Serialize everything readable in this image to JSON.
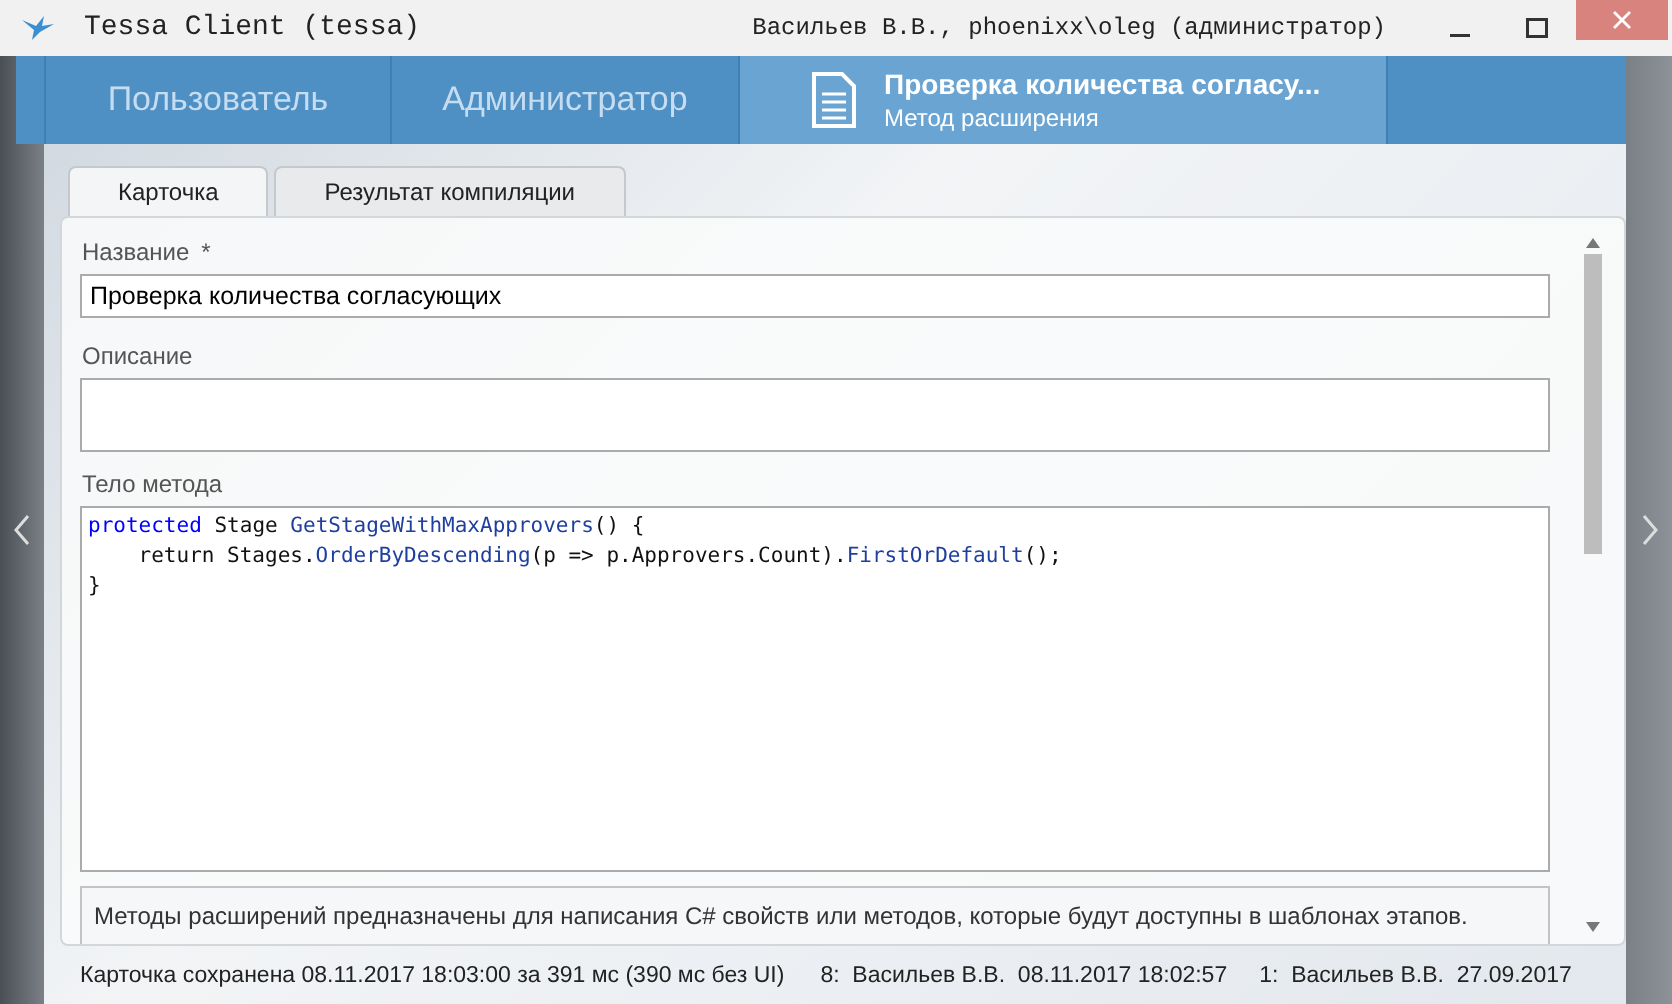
{
  "window": {
    "title": "Tessa Client (tessa)",
    "user": "Васильев В.В., phoenixx\\oleg (администратор)"
  },
  "nav_tabs": [
    {
      "kind": "plain",
      "label": "Пользователь",
      "selected": false
    },
    {
      "kind": "plain",
      "label": "Администратор",
      "selected": false
    },
    {
      "kind": "card",
      "label": "Проверка количества согласу...",
      "subtitle": "Метод расширения",
      "selected": true
    }
  ],
  "tabs": [
    {
      "label": "Карточка",
      "selected": true
    },
    {
      "label": "Результат компиляции",
      "selected": false
    }
  ],
  "fields": [
    {
      "kind": "text",
      "label": "Название",
      "required_mark": "*",
      "value": "Проверка количества согласующих"
    },
    {
      "kind": "multiline",
      "label": "Описание"
    }
  ],
  "code_editor": {
    "label": "Тело метода",
    "lines": [
      [
        {
          "kind": "keyword",
          "text": "protected"
        },
        {
          "kind": "plain",
          "text": " Stage "
        },
        {
          "kind": "method",
          "text": "GetStageWithMaxApprovers"
        },
        {
          "kind": "plain",
          "text": "() {"
        }
      ],
      [
        {
          "kind": "plain",
          "text": "    return Stages."
        },
        {
          "kind": "method",
          "text": "OrderByDescending"
        },
        {
          "kind": "plain",
          "text": "(p => p.Approvers.Count)."
        },
        {
          "kind": "method",
          "text": "FirstOrDefault"
        },
        {
          "kind": "plain",
          "text": "();"
        }
      ],
      [
        {
          "kind": "plain",
          "text": "}"
        }
      ]
    ]
  },
  "hint": "Методы расширений предназначены для написания C# свойств или методов, которые будут доступны в шаблонах этапов.",
  "status_bar": [
    "Карточка сохранена 08.11.2017 18:03:00 за 391 мс (390 мс без UI)",
    "8:  Васильев В.В.  08.11.2017 18:02:57",
    "1:  Васильев В.В.  27.09.2017"
  ]
}
